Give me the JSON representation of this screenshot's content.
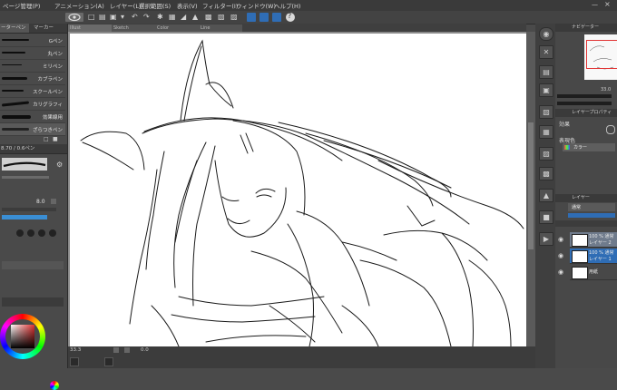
{
  "menu": {
    "items": [
      "ページ管理(P)",
      "アニメーション(A)",
      "レイヤー(L)",
      "選択範囲(S)",
      "表示(V)",
      "フィルター(I)",
      "ウィンドウ(W)",
      "ヘルプ(H)"
    ]
  },
  "left": {
    "tab_active": "ーターペン",
    "tab_other": "マーカー",
    "brushes": [
      "Gペン",
      "丸ペン",
      "ミリペン",
      "カブラペン",
      "スクールペン",
      "カリグラフィ",
      "効果線用",
      "ざらつきペン"
    ],
    "subtool_detail_title": "8.70 / 0.6ペン",
    "brush_size_value": "8.0",
    "color_wheel_label": "カラーサークル"
  },
  "doc_tabs": [
    "Illust",
    "Sketch",
    "Color",
    "Line"
  ],
  "right": {
    "navigator_title": "ナビゲーター",
    "zoom_value": "33.0",
    "layer_property_title": "レイヤープロパティ",
    "effect_label": "効果",
    "expression_color_label": "表現色",
    "expression_color_value": "カラー",
    "layer_panel_title": "レイヤー",
    "blend_mode": "通常",
    "layers": [
      {
        "line1": "100 % 通常",
        "line2": "レイヤー 2"
      },
      {
        "line1": "100 % 通常",
        "line2": "レイヤー 1"
      },
      {
        "line1": "",
        "line2": "用紙"
      }
    ]
  },
  "status": {
    "zoom": "33.3",
    "angle": "0.0"
  },
  "colors": {
    "panel": "#4a4a4a",
    "menu": "#3a3a3a",
    "canvas": "#ffffff",
    "accent_blue": "#2f6db5",
    "selected_layer": "#6f7b8c"
  }
}
